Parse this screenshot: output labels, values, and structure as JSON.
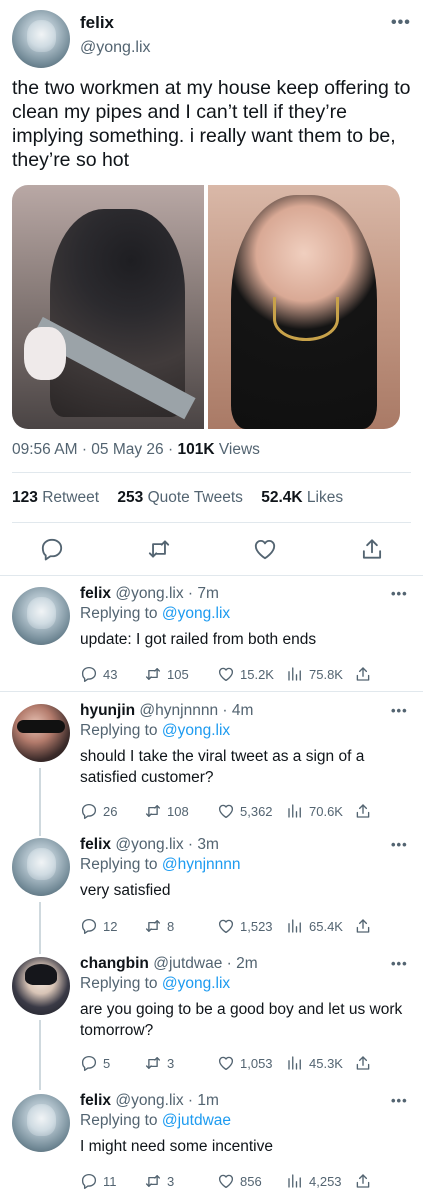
{
  "main_tweet": {
    "name": "felix",
    "handle": "@yong.lix",
    "more_icon": "more-horizontal-icon",
    "text": "the two workmen at my house keep offering to clean my pipes and I can’t tell if they’re implying something. i really want them to be, they’re so hot",
    "time": "09:56 AM",
    "date": "05 May 26",
    "views_count": "101K",
    "views_label": "Views",
    "retweets_count": "123",
    "retweets_label": "Retweet",
    "quotes_count": "253",
    "quotes_label": "Quote Tweets",
    "likes_count": "52.4K",
    "likes_label": "Likes",
    "action_icons": [
      "reply-icon",
      "retweet-icon",
      "like-icon",
      "share-icon"
    ]
  },
  "replies": [
    {
      "name": "felix",
      "handle": "@yong.lix",
      "time": "7m",
      "replying_prefix": "Replying to",
      "replying_to": "@yong.lix",
      "text": "update: I got railed from both ends",
      "replies": "43",
      "retweets": "105",
      "likes": "15.2K",
      "views": "75.8K"
    },
    {
      "name": "hyunjin",
      "handle": "@hynjnnnn",
      "time": "4m",
      "replying_prefix": "Replying to",
      "replying_to": "@yong.lix",
      "text": "should I take the viral tweet as a sign of a satisfied customer?",
      "replies": "26",
      "retweets": "108",
      "likes": "5,362",
      "views": "70.6K"
    },
    {
      "name": "felix",
      "handle": "@yong.lix",
      "time": "3m",
      "replying_prefix": "Replying to",
      "replying_to": "@hynjnnnn",
      "text": "very satisfied",
      "replies": "12",
      "retweets": "8",
      "likes": "1,523",
      "views": "65.4K"
    },
    {
      "name": "changbin",
      "handle": "@jutdwae",
      "time": "2m",
      "replying_prefix": "Replying to",
      "replying_to": "@yong.lix",
      "text": "are you going to be a good boy and let us work tomorrow?",
      "replies": "5",
      "retweets": "3",
      "likes": "1,053",
      "views": "45.3K"
    },
    {
      "name": "felix",
      "handle": "@yong.lix",
      "time": "1m",
      "replying_prefix": "Replying to",
      "replying_to": "@jutdwae",
      "text": "I might need some incentive",
      "replies": "11",
      "retweets": "3",
      "likes": "856",
      "views": "4,253"
    }
  ],
  "colors": {
    "text": "#0f1419",
    "secondary": "#536471",
    "link": "#1d9bf0",
    "divider": "#e1e8ed"
  }
}
